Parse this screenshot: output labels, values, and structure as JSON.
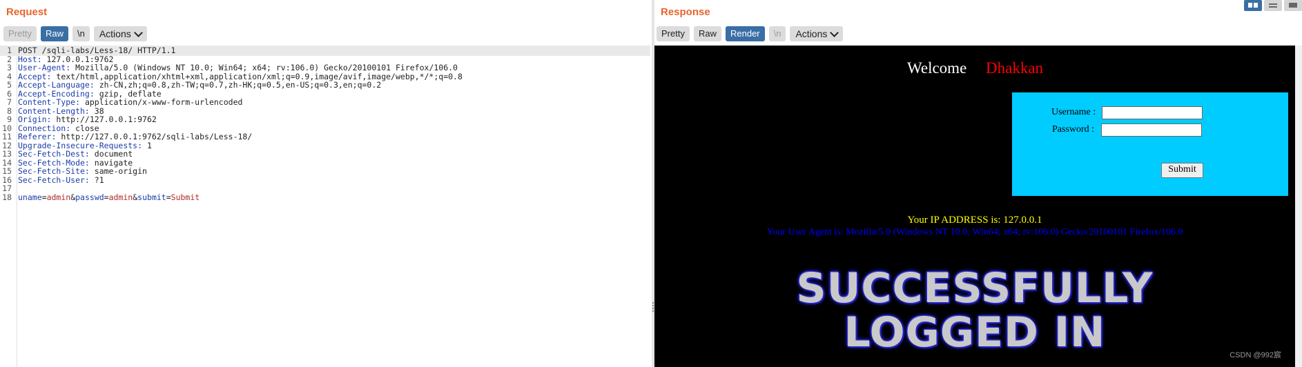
{
  "request": {
    "title": "Request",
    "toolbar": {
      "pretty": "Pretty",
      "raw": "Raw",
      "newline": "\\n",
      "actions": "Actions"
    },
    "headers": [
      {
        "n": "1",
        "text": "POST /sqli-labs/Less-18/ HTTP/1.1"
      },
      {
        "n": "2",
        "key": "Host:",
        "value": " 127.0.0.1:9762"
      },
      {
        "n": "3",
        "key": "User-Agent:",
        "value": " Mozilla/5.0 (Windows NT 10.0; Win64; x64; rv:106.0) Gecko/20100101 Firefox/106.0"
      },
      {
        "n": "4",
        "key": "Accept:",
        "value": " text/html,application/xhtml+xml,application/xml;q=0.9,image/avif,image/webp,*/*;q=0.8"
      },
      {
        "n": "5",
        "key": "Accept-Language:",
        "value": " zh-CN,zh;q=0.8,zh-TW;q=0.7,zh-HK;q=0.5,en-US;q=0.3,en;q=0.2"
      },
      {
        "n": "6",
        "key": "Accept-Encoding:",
        "value": " gzip, deflate"
      },
      {
        "n": "7",
        "key": "Content-Type:",
        "value": " application/x-www-form-urlencoded"
      },
      {
        "n": "8",
        "key": "Content-Length:",
        "value": " 38"
      },
      {
        "n": "9",
        "key": "Origin:",
        "value": " http://127.0.0.1:9762"
      },
      {
        "n": "10",
        "key": "Connection:",
        "value": " close"
      },
      {
        "n": "11",
        "key": "Referer:",
        "value": " http://127.0.0.1:9762/sqli-labs/Less-18/"
      },
      {
        "n": "12",
        "key": "Upgrade-Insecure-Requests:",
        "value": " 1"
      },
      {
        "n": "13",
        "key": "Sec-Fetch-Dest:",
        "value": " document"
      },
      {
        "n": "14",
        "key": "Sec-Fetch-Mode:",
        "value": " navigate"
      },
      {
        "n": "15",
        "key": "Sec-Fetch-Site:",
        "value": " same-origin"
      },
      {
        "n": "16",
        "key": "Sec-Fetch-User:",
        "value": " ?1"
      },
      {
        "n": "17",
        "text": ""
      }
    ],
    "body_line": {
      "n": "18",
      "params": [
        {
          "key": "uname",
          "value": "admin"
        },
        {
          "key": "passwd",
          "value": "admin"
        },
        {
          "key": "submit",
          "value": "Submit"
        }
      ],
      "eq": "=",
      "amp": "&"
    }
  },
  "response": {
    "title": "Response",
    "toolbar": {
      "pretty": "Pretty",
      "raw": "Raw",
      "render": "Render",
      "newline": "\\n",
      "actions": "Actions"
    },
    "page": {
      "welcome": "Welcome",
      "name": "Dhakkan",
      "username_label": "Username :",
      "password_label": "Password :",
      "submit": "Submit",
      "ip_line": "Your IP ADDRESS is: 127.0.0.1",
      "ua_line": "Your User Agent is: Mozilla/5.0 (Windows NT 10.0; Win64; x64; rv:106.0) Gecko/20100101 Firefox/106.0",
      "banner_line1": "SUCCESSFULLY",
      "banner_line2": "LOGGED IN"
    }
  },
  "watermark": "CSDN @992宸",
  "colors": {
    "title": "#e8642e",
    "active_tab": "#3a6ea5",
    "login_box": "#00ccff",
    "header_key": "#1a3ca8",
    "param_value": "#b02a2a"
  }
}
